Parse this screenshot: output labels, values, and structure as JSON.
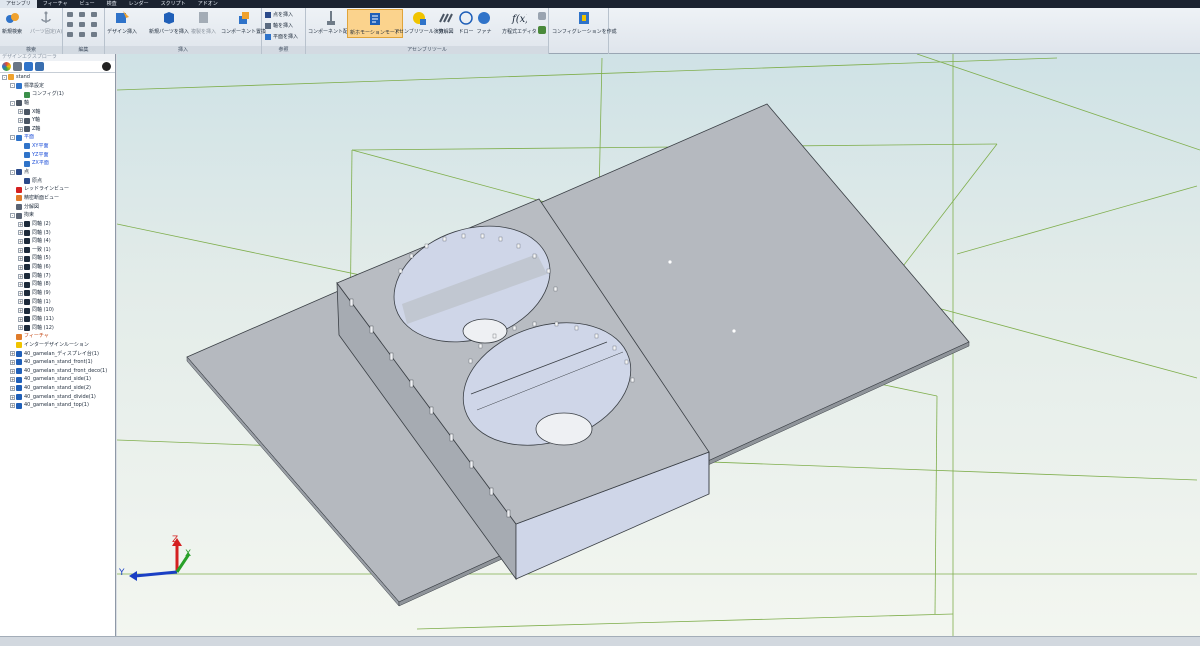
{
  "menubar": {
    "items": [
      {
        "label": "アセンブリ"
      },
      {
        "label": "フィーチャ"
      },
      {
        "label": "ビュー"
      },
      {
        "label": "検査"
      },
      {
        "label": "レンダー"
      },
      {
        "label": "スクリプト"
      },
      {
        "label": "アドオン"
      }
    ]
  },
  "ribbon": {
    "groups": {
      "project": "検索",
      "edit": "編集",
      "insert": "挿入",
      "reference": "参照",
      "assembly_tools": "アセンブリツール"
    },
    "buttons": {
      "new_project": "新規検索",
      "parts_list": "パーツ固定(A)",
      "design_insert": "デザイン挿入",
      "new_part": "新規パーツを挿入",
      "copy_insert": "複製を挿入",
      "component_replace": "コンポーネント置換",
      "insert_point": "点を挿入",
      "insert_axis": "軸を挿入",
      "insert_plane": "平面を挿入",
      "component_place": "コンポーネント配置",
      "motion_mode": "新ホモーションモード",
      "assembly_tools": "アセンブリツール演算",
      "exploded": "分解図",
      "draw": "ドロー",
      "formula": "ファナ",
      "equation_editor": "方程式エディタ",
      "config_create": "コンフィグレーションを作成"
    }
  },
  "panel": {
    "title": "デザインエクスプローラ",
    "tree": [
      {
        "label": "stand",
        "indent": 0,
        "toggle": "-",
        "icon": "assembly-icon"
      },
      {
        "label": "標準設定",
        "indent": 1,
        "toggle": "-",
        "icon": "folder-icon"
      },
      {
        "label": "コンフィグ(1)",
        "indent": 2,
        "toggle": "",
        "icon": "config-icon"
      },
      {
        "label": "軸",
        "indent": 1,
        "toggle": "-",
        "icon": "axis-icon"
      },
      {
        "label": "X軸",
        "indent": 2,
        "toggle": "+",
        "icon": "axis-icon"
      },
      {
        "label": "Y軸",
        "indent": 2,
        "toggle": "+",
        "icon": "axis-icon"
      },
      {
        "label": "Z軸",
        "indent": 2,
        "toggle": "+",
        "icon": "axis-icon"
      },
      {
        "label": "平面",
        "indent": 1,
        "toggle": "-",
        "icon": "plane-icon",
        "color": "blue"
      },
      {
        "label": "XY平面",
        "indent": 2,
        "toggle": "",
        "icon": "plane-icon",
        "color": "blue"
      },
      {
        "label": "YZ平面",
        "indent": 2,
        "toggle": "",
        "icon": "plane-icon",
        "color": "blue"
      },
      {
        "label": "ZX平面",
        "indent": 2,
        "toggle": "",
        "icon": "plane-icon",
        "color": "blue"
      },
      {
        "label": "点",
        "indent": 1,
        "toggle": "-",
        "icon": "point-icon"
      },
      {
        "label": "原点",
        "indent": 2,
        "toggle": "",
        "icon": "point-icon"
      },
      {
        "label": "レッドラインビュー",
        "indent": 1,
        "toggle": "",
        "icon": "redline-icon"
      },
      {
        "label": "精密断面ビュー",
        "indent": 1,
        "toggle": "",
        "icon": "section-icon"
      },
      {
        "label": "分解図",
        "indent": 1,
        "toggle": "",
        "icon": "exploded-icon"
      },
      {
        "label": "拘束",
        "indent": 1,
        "toggle": "-",
        "icon": "constraint-icon"
      },
      {
        "label": "同軸 (2)",
        "indent": 2,
        "toggle": "+",
        "icon": "coaxial-icon"
      },
      {
        "label": "同軸 (3)",
        "indent": 2,
        "toggle": "+",
        "icon": "coaxial-icon"
      },
      {
        "label": "同軸 (4)",
        "indent": 2,
        "toggle": "+",
        "icon": "coaxial-icon"
      },
      {
        "label": "一致 (1)",
        "indent": 2,
        "toggle": "+",
        "icon": "coincident-icon"
      },
      {
        "label": "同軸 (5)",
        "indent": 2,
        "toggle": "+",
        "icon": "coaxial-icon"
      },
      {
        "label": "同軸 (6)",
        "indent": 2,
        "toggle": "+",
        "icon": "coaxial-icon"
      },
      {
        "label": "同軸 (7)",
        "indent": 2,
        "toggle": "+",
        "icon": "coaxial-icon"
      },
      {
        "label": "同軸 (8)",
        "indent": 2,
        "toggle": "+",
        "icon": "coaxial-icon"
      },
      {
        "label": "同軸 (9)",
        "indent": 2,
        "toggle": "+",
        "icon": "coaxial-icon"
      },
      {
        "label": "同軸 (1)",
        "indent": 2,
        "toggle": "+",
        "icon": "coaxial-icon"
      },
      {
        "label": "同軸 (10)",
        "indent": 2,
        "toggle": "+",
        "icon": "coaxial-icon"
      },
      {
        "label": "同軸 (11)",
        "indent": 2,
        "toggle": "+",
        "icon": "coaxial-icon"
      },
      {
        "label": "同軸 (12)",
        "indent": 2,
        "toggle": "+",
        "icon": "coaxial-icon"
      },
      {
        "label": "フィーチャ",
        "indent": 1,
        "toggle": "",
        "icon": "feature-icon",
        "color": "orange"
      },
      {
        "label": "インターデザインルーション",
        "indent": 1,
        "toggle": "",
        "icon": "interference-icon"
      },
      {
        "label": "40_gamelan_ディスプレイ台(1)",
        "indent": 1,
        "toggle": "+",
        "icon": "part-icon"
      },
      {
        "label": "40_gamelan_stand_front(1)",
        "indent": 1,
        "toggle": "+",
        "icon": "part-icon"
      },
      {
        "label": "40_gamelan_stand_front_deco(1)",
        "indent": 1,
        "toggle": "+",
        "icon": "part-icon"
      },
      {
        "label": "40_gamelan_stand_side(1)",
        "indent": 1,
        "toggle": "+",
        "icon": "part-icon"
      },
      {
        "label": "40_gamelan_stand_side(2)",
        "indent": 1,
        "toggle": "+",
        "icon": "part-icon"
      },
      {
        "label": "40_gamelan_stand_divide(1)",
        "indent": 1,
        "toggle": "+",
        "icon": "part-icon"
      },
      {
        "label": "40_gamelan_stand_top(1)",
        "indent": 1,
        "toggle": "+",
        "icon": "part-icon"
      }
    ]
  },
  "viewport": {
    "triad": {
      "z": "Z",
      "y": "Y",
      "x": "X"
    },
    "colors": {
      "model": "#b3b7bd",
      "model_dark": "#8f949a",
      "edge": "#3a3f45",
      "grid": "#7fae4c",
      "light_face": "#cfd6e8"
    }
  }
}
